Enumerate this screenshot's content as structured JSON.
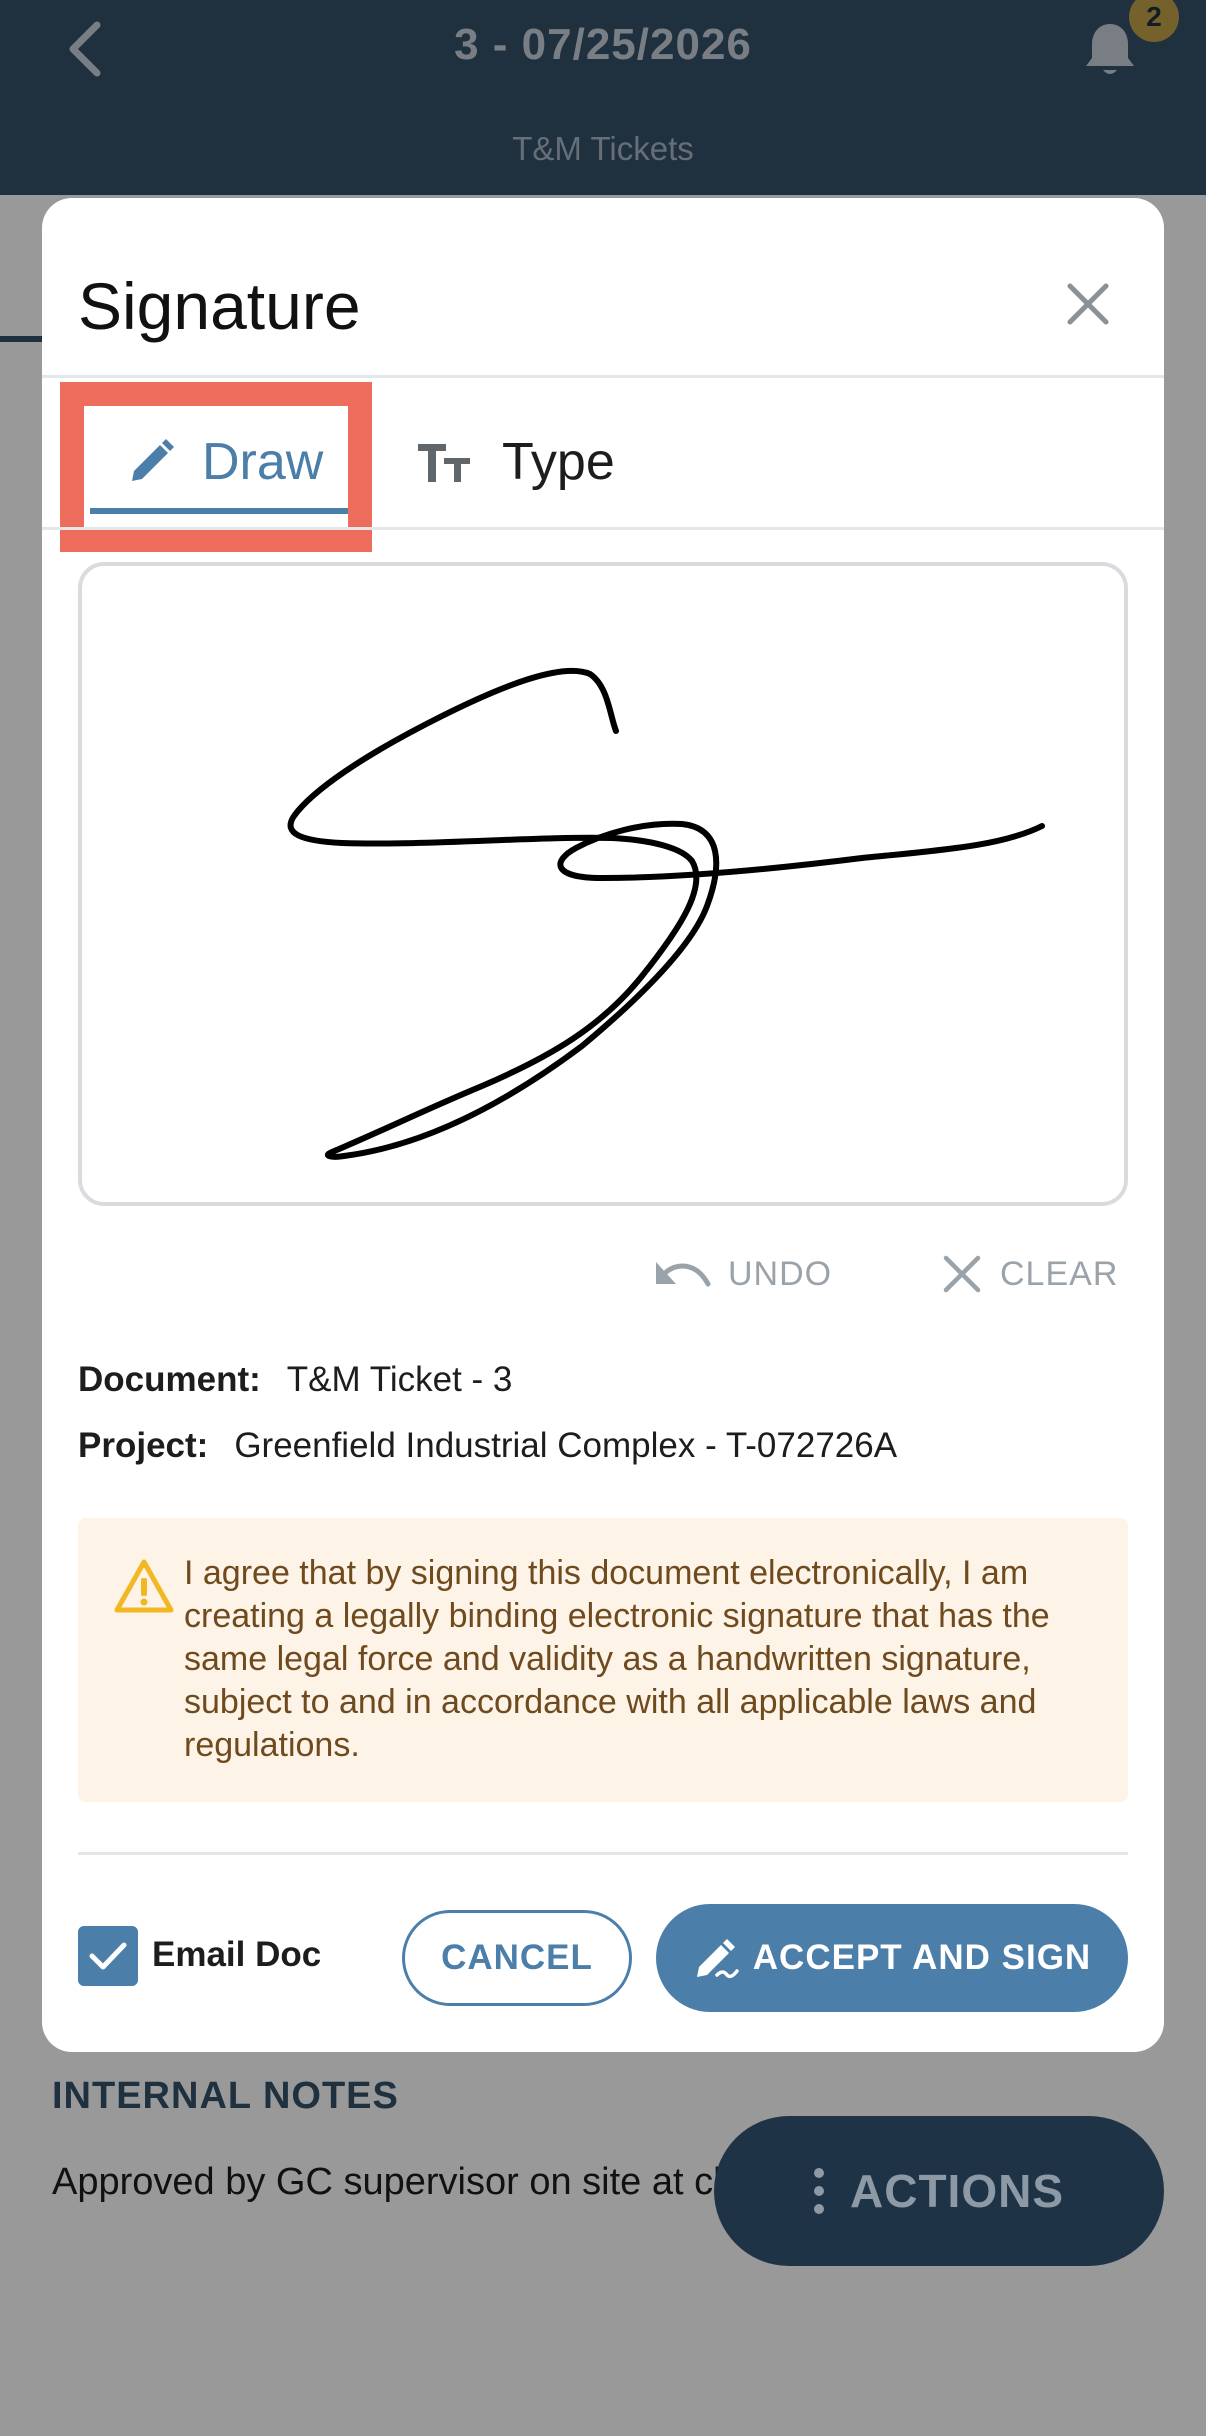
{
  "header": {
    "title": "3 - 07/25/2026",
    "subtitle": "T&M Tickets",
    "notification_count": "2",
    "icons": {
      "back": "chevron-left-icon",
      "bell": "bell-icon"
    }
  },
  "background": {
    "notes_heading": "INTERNAL NOTES",
    "notes_text": "Approved by GC supervisor on site at close-out walk."
  },
  "actions_button": {
    "label": "ACTIONS",
    "icon": "more-vertical-icon"
  },
  "modal": {
    "title": "Signature",
    "tabs": [
      {
        "label": "Draw",
        "icon": "pencil-icon",
        "selected": true
      },
      {
        "label": "Type",
        "icon": "text-size-icon",
        "selected": false
      }
    ],
    "undo_label": "UNDO",
    "clear_label": "CLEAR",
    "document_label": "Document:",
    "document_value": "T&M Ticket - 3",
    "project_label": "Project:",
    "project_value": "Greenfield Industrial Complex - T-072726A",
    "agreement_text": "I agree that by signing this document electronically, I am creating a legally binding electronic signature that has the same legal force and validity as a handwritten signature, subject to and in accordance with all applicable laws and regulations.",
    "email_doc_label": "Email Doc",
    "email_doc_checked": true,
    "cancel_label": "CANCEL",
    "accept_label": "ACCEPT AND SIGN"
  },
  "colors": {
    "header_bg": "#355169",
    "accent": "#4b7ea8",
    "highlight": "#ee6c5c",
    "agreement_bg": "#fdf3e6",
    "warning": "#f2b824"
  }
}
